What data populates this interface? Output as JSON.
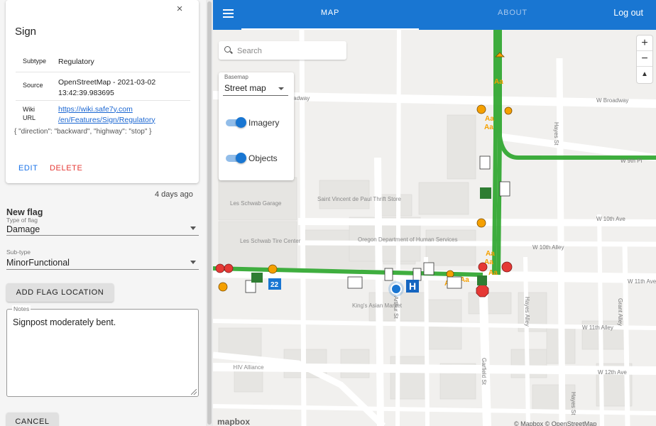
{
  "feature_card": {
    "title": "Sign",
    "close_symbol": "×",
    "attributes": [
      {
        "key": "Subtype",
        "value": "Regulatory"
      },
      {
        "key": "Source",
        "value": "OpenStreetMap - 2021-03-02",
        "value2": "13:42:39.983695"
      },
      {
        "key": "Wiki",
        "key2": "URL",
        "value": "https://wiki.safe7y.com",
        "value2": "/en/Features/Sign/Regulatory"
      }
    ],
    "properties_text": "{ \"direction\": \"backward\", \"highway\": \"stop\" }",
    "edit_label": "EDIT",
    "delete_label": "DELETE"
  },
  "age": "4 days ago",
  "new_flag": {
    "heading": "New flag",
    "type_label": "Type of flag",
    "type_value": "Damage",
    "subtype_label": "Sub-type",
    "subtype_value": "MinorFunctional",
    "add_location_label": "ADD FLAG LOCATION",
    "notes_label": "Notes",
    "notes_value": "Signpost moderately bent.",
    "cancel_label": "CANCEL"
  },
  "header": {
    "tabs": [
      {
        "label": "MAP",
        "active": true
      },
      {
        "label": "ABOUT",
        "active": false
      }
    ],
    "logout_label": "Log out",
    "color": "#1976d2"
  },
  "map_controls": {
    "search_placeholder": "Search",
    "basemap_label": "Basemap",
    "basemap_value": "Street map",
    "layers": [
      {
        "label": "Imagery",
        "on": true
      },
      {
        "label": "Objects",
        "on": true
      }
    ],
    "zoom_in": "+",
    "zoom_out": "−",
    "compass": "▲"
  },
  "map_labels": {
    "streets": [
      "W Broadway",
      "W 9th Pl",
      "W 10th Ave",
      "W 10th Alley",
      "W 11th Ave",
      "W 11th Alley",
      "W 12th Ave",
      "Hayes St",
      "Arthur St",
      "Garfield St",
      "Grant Alley",
      "Hayes Alley",
      "roadway"
    ],
    "pois": [
      "Saint Vincent de Paul Thrift Store",
      "Les Schwab Garage",
      "Les Schwab Tire Center",
      "Oregon Department of Human Services",
      "King's Asian Market",
      "HIV Alliance"
    ],
    "mapbox": "mapbox",
    "attribution": "© Mapbox © OpenStreetMap"
  },
  "colors": {
    "route": "#2db02d",
    "accent": "#1976d2",
    "delete": "#e53935"
  }
}
